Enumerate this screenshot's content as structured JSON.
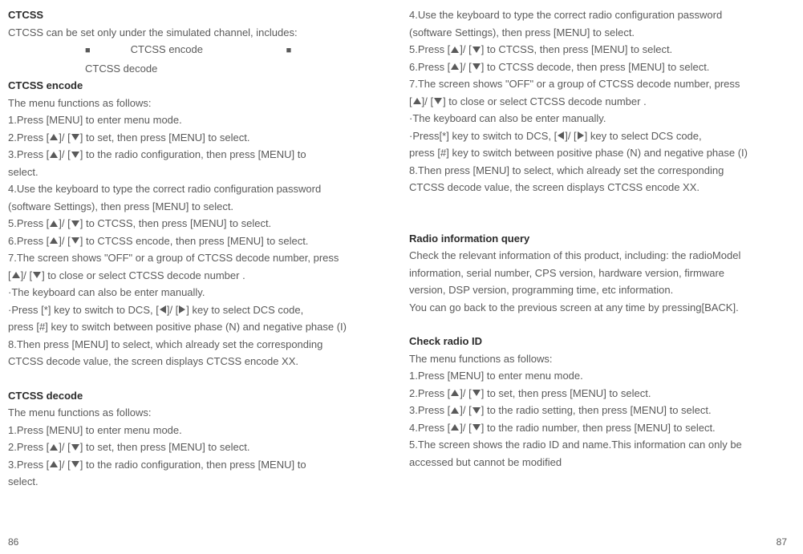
{
  "left": {
    "h1": "CTCSS",
    "l1": "CTCSS can be set only under the simulated channel, includes:",
    "opt1": "CTCSS encode",
    "opt2": "CTCSS decode",
    "h2": "CTCSS encode",
    "l2": "The menu functions as follows:",
    "l3": "1.Press [MENU] to enter menu mode.",
    "l4a": "2.Press [",
    "l4b": "]/ [",
    "l4c": "] to set, then press [MENU] to select.",
    "l5a": "3.Press [",
    "l5b": "]/ [",
    "l5c": "] to the radio configuration, then press [MENU] to",
    "l6": "select.",
    "l7": "4.Use the keyboard to type the correct radio configuration password",
    "l8": "(software Settings), then press [MENU] to select.",
    "l9a": "5.Press [",
    "l9b": "]/ [",
    "l9c": "] to CTCSS, then press [MENU] to select.",
    "l10a": "6.Press [",
    "l10b": "]/ [",
    "l10c": "] to CTCSS encode, then press [MENU] to select.",
    "l11": "7.The screen shows \"OFF\" or a group of CTCSS decode number, press",
    "l12a": "[",
    "l12b": "]/ [",
    "l12c": "] to close or select CTCSS decode number .",
    "l13": "·The keyboard can also be enter manually.",
    "l14a": "·Press [*] key to switch to DCS,  [",
    "l14b": "]/ [",
    "l14c": "] key to select DCS code,",
    "l15": "press [#] key to switch between positive phase (N) and negative phase (I)",
    "l16": "8.Then press [MENU] to select, which already set the corresponding",
    "l17": "CTCSS decode value, the screen displays CTCSS encode XX.",
    "h3": "CTCSS decode",
    "l18": "The menu functions as follows:",
    "l19": "1.Press [MENU] to enter menu mode.",
    "l20a": "2.Press [",
    "l20b": "]/ [",
    "l20c": "] to set, then press [MENU] to select.",
    "l21a": "3.Press [",
    "l21b": "]/ [",
    "l21c": "] to the radio configuration, then press [MENU] to",
    "l22": "select.",
    "page": "86"
  },
  "right": {
    "l1": "4.Use the keyboard to type the correct radio configuration password",
    "l2": "(software Settings), then press [MENU] to select.",
    "l3a": "5.Press [",
    "l3b": "]/ [",
    "l3c": "] to CTCSS, then press [MENU] to select.",
    "l4a": "6.Press [",
    "l4b": "]/ [",
    "l4c": "] to CTCSS decode, then press [MENU] to select.",
    "l5": "7.The screen shows \"OFF\" or a group of CTCSS decode number, press",
    "l6a": "[",
    "l6b": "]/ [",
    "l6c": "] to close or select CTCSS decode number .",
    "l7": "·The keyboard can also be enter manually.",
    "l8a": "·Press[*] key to switch to DCS,  [",
    "l8b": "]/ [",
    "l8c": "] key to select DCS code,",
    "l9": "press [#] key to switch between positive phase (N) and negative phase (I)",
    "l10": "8.Then press  [MENU] to select, which already set the corresponding",
    "l11": "CTCSS decode value, the screen displays CTCSS encode XX.",
    "h1": "Radio information query",
    "l12": "Check the relevant information of this product, including: the radioModel",
    "l13": "information, serial number, CPS version, hardware version, firmware",
    "l14": "version, DSP version, programming time, etc information.",
    "l15": "You can go back to the previous screen at any time by pressing[BACK].",
    "h2": "Check radio ID",
    "l16": "The menu functions as follows:",
    "l17": "1.Press [MENU] to enter menu mode.",
    "l18a": "2.Press [",
    "l18b": "]/ [",
    "l18c": "] to set, then press [MENU] to select.",
    "l19a": "3.Press [",
    "l19b": "]/ [",
    "l19c": "] to the radio setting, then press [MENU] to select.",
    "l20a": "4.Press [",
    "l20b": "]/ [",
    "l20c": "] to the radio number, then press [MENU] to select.",
    "l21": "5.The screen shows the radio ID and name.This information can only be",
    "l22": "accessed but cannot be modified",
    "page": "87"
  }
}
